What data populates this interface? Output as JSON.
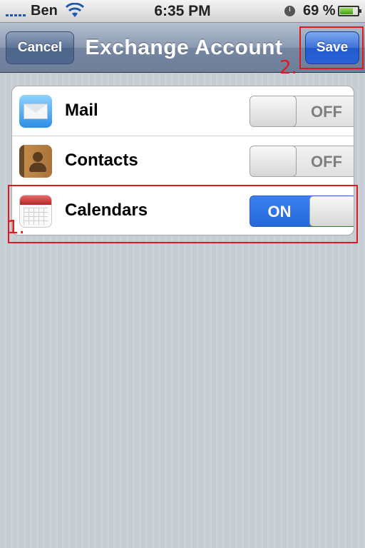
{
  "status_bar": {
    "carrier": "Ben",
    "time": "6:35 PM",
    "battery_percent": "69 %",
    "battery_level": 0.69,
    "icons": [
      "signal-icon",
      "wifi-icon",
      "clock-icon",
      "battery-icon"
    ]
  },
  "nav": {
    "title": "Exchange Account",
    "cancel_label": "Cancel",
    "save_label": "Save"
  },
  "settings": {
    "rows": [
      {
        "label": "Mail",
        "icon": "mail-icon",
        "toggle": "OFF",
        "enabled": false
      },
      {
        "label": "Contacts",
        "icon": "contacts-icon",
        "toggle": "OFF",
        "enabled": false
      },
      {
        "label": "Calendars",
        "icon": "calendars-icon",
        "toggle": "ON",
        "enabled": true
      }
    ]
  },
  "annotations": {
    "step1": "1.",
    "step2": "2.",
    "color": "#e01a1a"
  },
  "colors": {
    "nav_bar": "#7586a1",
    "save_button": "#2a62d8",
    "toggle_on": "#2568da",
    "background": "#c5ccd4"
  }
}
